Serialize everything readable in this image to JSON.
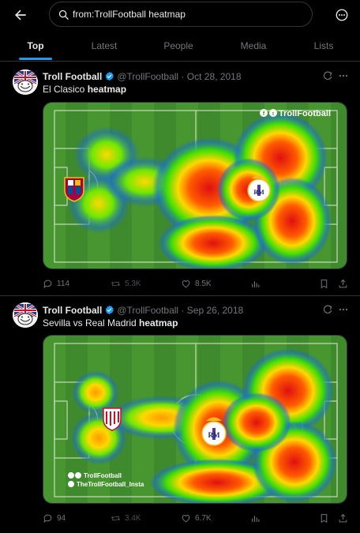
{
  "search": {
    "query": "from:TrollFootball heatmap"
  },
  "tabs": [
    {
      "label": "Top",
      "active": true
    },
    {
      "label": "Latest",
      "active": false
    },
    {
      "label": "People",
      "active": false
    },
    {
      "label": "Media",
      "active": false
    },
    {
      "label": "Lists",
      "active": false
    }
  ],
  "tweets": [
    {
      "name": "Troll Football",
      "handle": "@TrollFootball",
      "separator": "·",
      "date": "Oct 28, 2018",
      "text_prefix": "El Clasico ",
      "text_bold": "heatmap",
      "watermark": "TrollFootball",
      "replies": "114",
      "retweets": "5.3K",
      "likes": "8.5K"
    },
    {
      "name": "Troll Football",
      "handle": "@TrollFootball",
      "separator": "·",
      "date": "Sep 26, 2018",
      "text_prefix": "Sevilla vs Real Madrid ",
      "text_bold": "heatmap",
      "watermark_line1": "TrollFootball",
      "watermark_line2": "TheTrollFootball_Insta",
      "replies": "94",
      "retweets": "3.4K",
      "likes": "6.7K"
    }
  ],
  "colors": {
    "accent": "#1d9bf0",
    "text": "#e7e9ea",
    "muted": "#71767b",
    "border": "#2f3336",
    "pitch": "#3f8a2c"
  }
}
